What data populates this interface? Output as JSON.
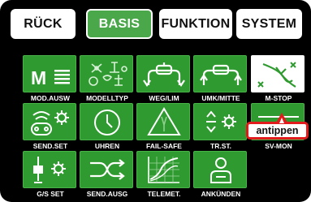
{
  "tabs": [
    {
      "label": "RÜCK",
      "active": false
    },
    {
      "label": "BASIS",
      "active": true
    },
    {
      "label": "FUNKTION",
      "active": false
    },
    {
      "label": "SYSTEM",
      "active": false
    }
  ],
  "tiles": [
    {
      "label": "MOD.AUSW",
      "icon": "model-select-icon"
    },
    {
      "label": "MODELLTYP",
      "icon": "model-type-icon"
    },
    {
      "label": "WEG/LIM",
      "icon": "servo-travel-icon"
    },
    {
      "label": "UMK/MITTE",
      "icon": "servo-reverse-center-icon"
    },
    {
      "label": "M-STOP",
      "icon": "motor-stop-icon",
      "selected": true
    },
    {
      "label": "SEND.SET",
      "icon": "transmitter-settings-icon"
    },
    {
      "label": "UHREN",
      "icon": "clock-icon"
    },
    {
      "label": "FAIL-SAFE",
      "icon": "fail-safe-icon"
    },
    {
      "label": "TR.ST.",
      "icon": "trim-step-icon"
    },
    {
      "label": "SV-MON",
      "icon": "servo-monitor-icon"
    },
    {
      "label": "G/S SET",
      "icon": "gas-settings-icon"
    },
    {
      "label": "SEND.AUSG",
      "icon": "transmitter-output-icon"
    },
    {
      "label": "TELEMET.",
      "icon": "telemetry-icon"
    },
    {
      "label": "ANKÜNDEN",
      "icon": "announcement-icon"
    }
  ],
  "callout": {
    "label": "antippen"
  },
  "colors": {
    "tile": "#2f9a2f",
    "active_tab": "#4aa84a",
    "callout_border": "#e11b1b",
    "background": "#000000"
  }
}
